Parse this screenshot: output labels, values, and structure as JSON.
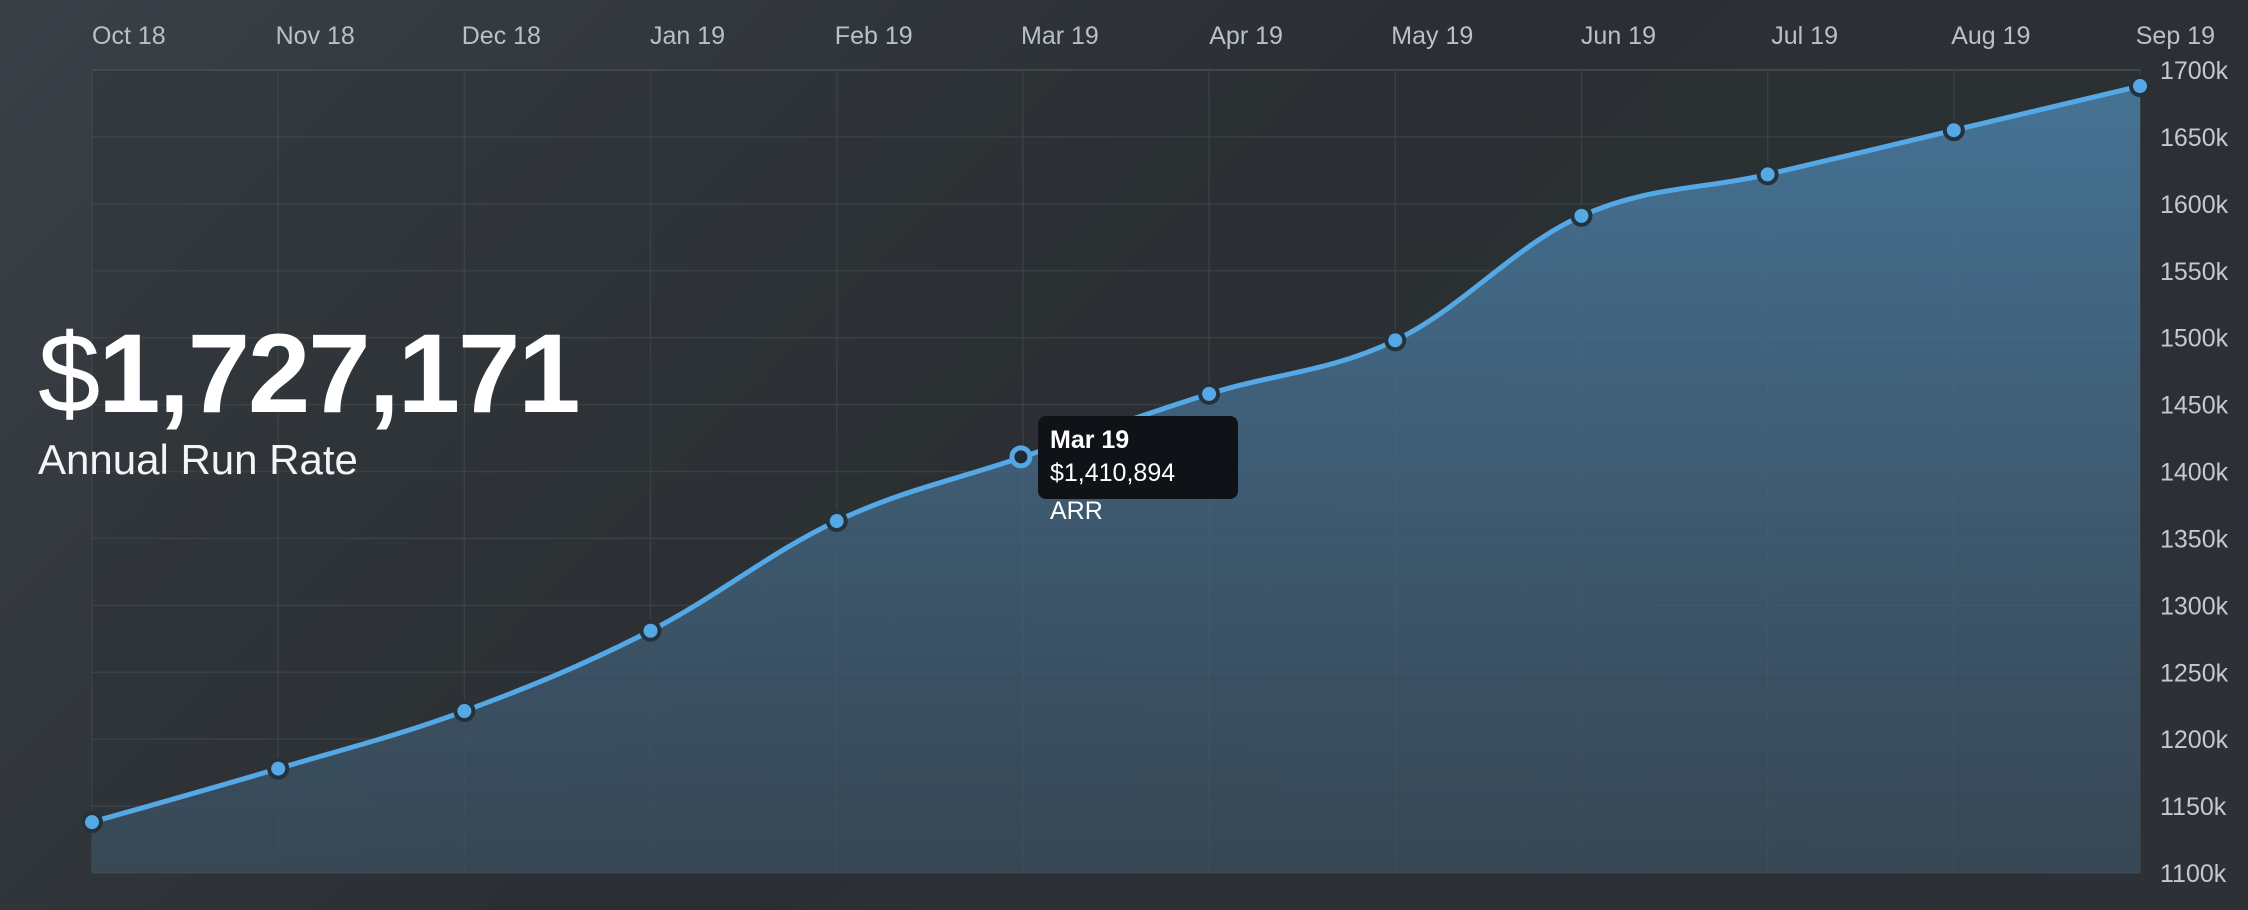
{
  "kpi": {
    "currency": "$",
    "amount": "1,727,171",
    "label": "Annual Run Rate"
  },
  "tooltip": {
    "title": "Mar 19",
    "value": "$1,410,894 ARR"
  },
  "colors": {
    "line": "#55a8e6",
    "area_top": "#4a7da3",
    "grid": "#4a5157",
    "marker_stroke": "#27313a"
  },
  "chart_data": {
    "type": "area",
    "categories": [
      "Oct 18",
      "Nov 18",
      "Dec 18",
      "Jan 19",
      "Feb 19",
      "Mar 19",
      "Apr 19",
      "May 19",
      "Jun 19",
      "Jul 19",
      "Aug 19",
      "Sep 19"
    ],
    "values": [
      1138,
      1178,
      1221,
      1281,
      1363,
      1410.894,
      1458,
      1498,
      1591,
      1622,
      1655,
      1688
    ],
    "y_ticks": [
      "1100k",
      "1150k",
      "1200k",
      "1250k",
      "1300k",
      "1350k",
      "1400k",
      "1450k",
      "1500k",
      "1550k",
      "1600k",
      "1650k",
      "1700k"
    ],
    "ylim": [
      1100,
      1700
    ],
    "y_axis_position": "right",
    "x_axis_position": "top",
    "grid": true,
    "highlighted_point": "Mar 19"
  }
}
